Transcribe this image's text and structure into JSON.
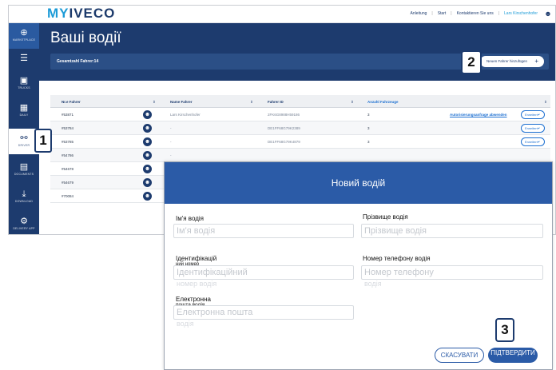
{
  "app": {
    "logo_my": "MY",
    "logo_brand": "IVECO",
    "topnav": [
      "Anleitung",
      "Start",
      "Kontaktieren Sie uns",
      "Lars Kirschenhofer"
    ]
  },
  "sidebar": {
    "items": [
      {
        "label": "MARKETPLACE",
        "icon": "plus-circle-icon"
      },
      {
        "label": "",
        "icon": "menu-icon"
      },
      {
        "label": "TRUCKS",
        "icon": "truck-icon"
      },
      {
        "label": "DAILY",
        "icon": "van-icon"
      },
      {
        "label": "DRIVER",
        "icon": "drivers-icon"
      },
      {
        "label": "DOCUMENTS",
        "icon": "document-icon"
      },
      {
        "label": "DOWNLOAD",
        "icon": "download-icon"
      },
      {
        "label": "DELIVERY APP",
        "icon": "delivery-icon"
      }
    ]
  },
  "header": {
    "title": "Ваші водії",
    "summary": "Gesamtzahl Fahrer:14",
    "add_button": "Neuen Fahrer hinzufügen"
  },
  "table": {
    "columns": [
      "Nr.e Fahrer",
      "Name Fahrer",
      "Fahrer ID",
      "Anzahl Fahrzeuge"
    ],
    "rows": [
      {
        "nr": "#53871",
        "name": "Lars Kirschenhofer",
        "id": "2FK6G8988H59186",
        "count": "3",
        "link": "Autorisierungsanfrage abwenden",
        "action": "Erweitern"
      },
      {
        "nr": "#53784",
        "name": "-",
        "id": "DE1FF68G79K2389",
        "count": "3",
        "link": "",
        "action": "Erweitern"
      },
      {
        "nr": "#53785",
        "name": "-",
        "id": "DE1FF68G79K4879",
        "count": "3",
        "link": "",
        "action": "Erweitern"
      },
      {
        "nr": "#54786",
        "name": "-",
        "id": "",
        "count": "",
        "link": "",
        "action": ""
      },
      {
        "nr": "#54678",
        "name": "-",
        "id": "",
        "count": "",
        "link": "",
        "action": ""
      },
      {
        "nr": "#54679",
        "name": "-",
        "id": "",
        "count": "",
        "link": "",
        "action": ""
      },
      {
        "nr": "#70084",
        "name": "-",
        "id": "",
        "count": "",
        "link": "",
        "action": ""
      }
    ]
  },
  "steps": [
    "1",
    "2",
    "3"
  ],
  "modal": {
    "title": "Новий водій",
    "first_name_label": "Ім'я водія",
    "first_name_placeholder": "Ім'я водія",
    "last_name_label": "Прізвище водія",
    "last_name_placeholder": "Прізвище водія",
    "id_label_1": "Ідентифікацій",
    "id_label_2": "ний номер",
    "id_label_3": "в",
    "id_placeholder": "Ідентифікаційний",
    "id_placeholder_overflow": "номер водія",
    "phone_label": "Номер телефону водія",
    "phone_placeholder": "Номер телефону",
    "phone_placeholder_overflow": "водія",
    "email_label_1": "Електронна",
    "email_label_2": "пошта водія",
    "email_placeholder": "Електронна пошта",
    "email_placeholder_overflow": "водія",
    "cancel_button": "СКАСУВАТИ",
    "confirm_button": "ПІДТВЕРДИТИ"
  },
  "colors": {
    "navy": "#1d3b6e",
    "modal_blue": "#2b5ba7",
    "accent": "#1c9bd7"
  }
}
